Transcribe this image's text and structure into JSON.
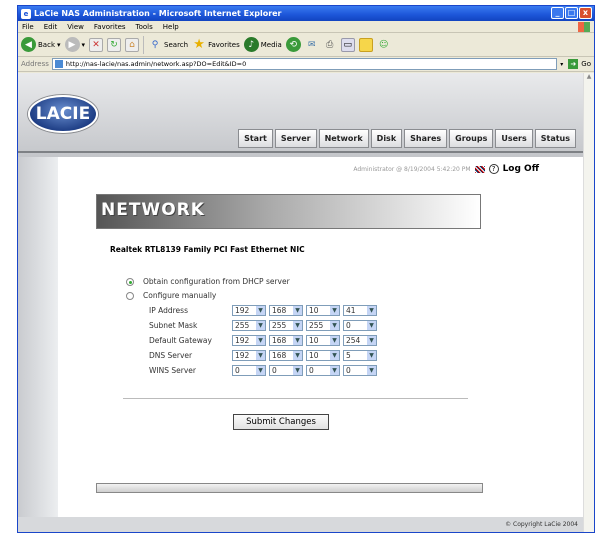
{
  "window": {
    "title": "LaCie NAS Administration - Microsoft Internet Explorer",
    "min": "_",
    "max": "□",
    "close": "x"
  },
  "menu": [
    "File",
    "Edit",
    "View",
    "Favorites",
    "Tools",
    "Help"
  ],
  "toolbar": {
    "back": "Back",
    "search": "Search",
    "favorites": "Favorites",
    "media": "Media"
  },
  "address": {
    "label": "Address",
    "url": "http://nas-lacie/nas.admin/network.asp?DO=Edit&ID=0",
    "go": "Go"
  },
  "logo": "LACIE",
  "tabs": [
    "Start",
    "Server",
    "Network",
    "Disk",
    "Shares",
    "Groups",
    "Users",
    "Status"
  ],
  "status": {
    "text": "Administrator @ 8/19/2004 5:42:20 PM",
    "help": "?",
    "logoff": "Log Off"
  },
  "section_title": "NETWORK",
  "nic": "Realtek RTL8139 Family PCI Fast Ethernet NIC",
  "options": {
    "dhcp": "Obtain configuration from DHCP server",
    "manual": "Configure manually",
    "selected": "dhcp"
  },
  "fields": [
    {
      "label": "IP Address",
      "octets": [
        "192",
        "168",
        "10",
        "41"
      ]
    },
    {
      "label": "Subnet Mask",
      "octets": [
        "255",
        "255",
        "255",
        "0"
      ]
    },
    {
      "label": "Default Gateway",
      "octets": [
        "192",
        "168",
        "10",
        "254"
      ]
    },
    {
      "label": "DNS Server",
      "octets": [
        "192",
        "168",
        "10",
        "5"
      ]
    },
    {
      "label": "WINS Server",
      "octets": [
        "0",
        "0",
        "0",
        "0"
      ]
    }
  ],
  "submit": "Submit Changes",
  "copyright": "© Copyright LaCie 2004"
}
